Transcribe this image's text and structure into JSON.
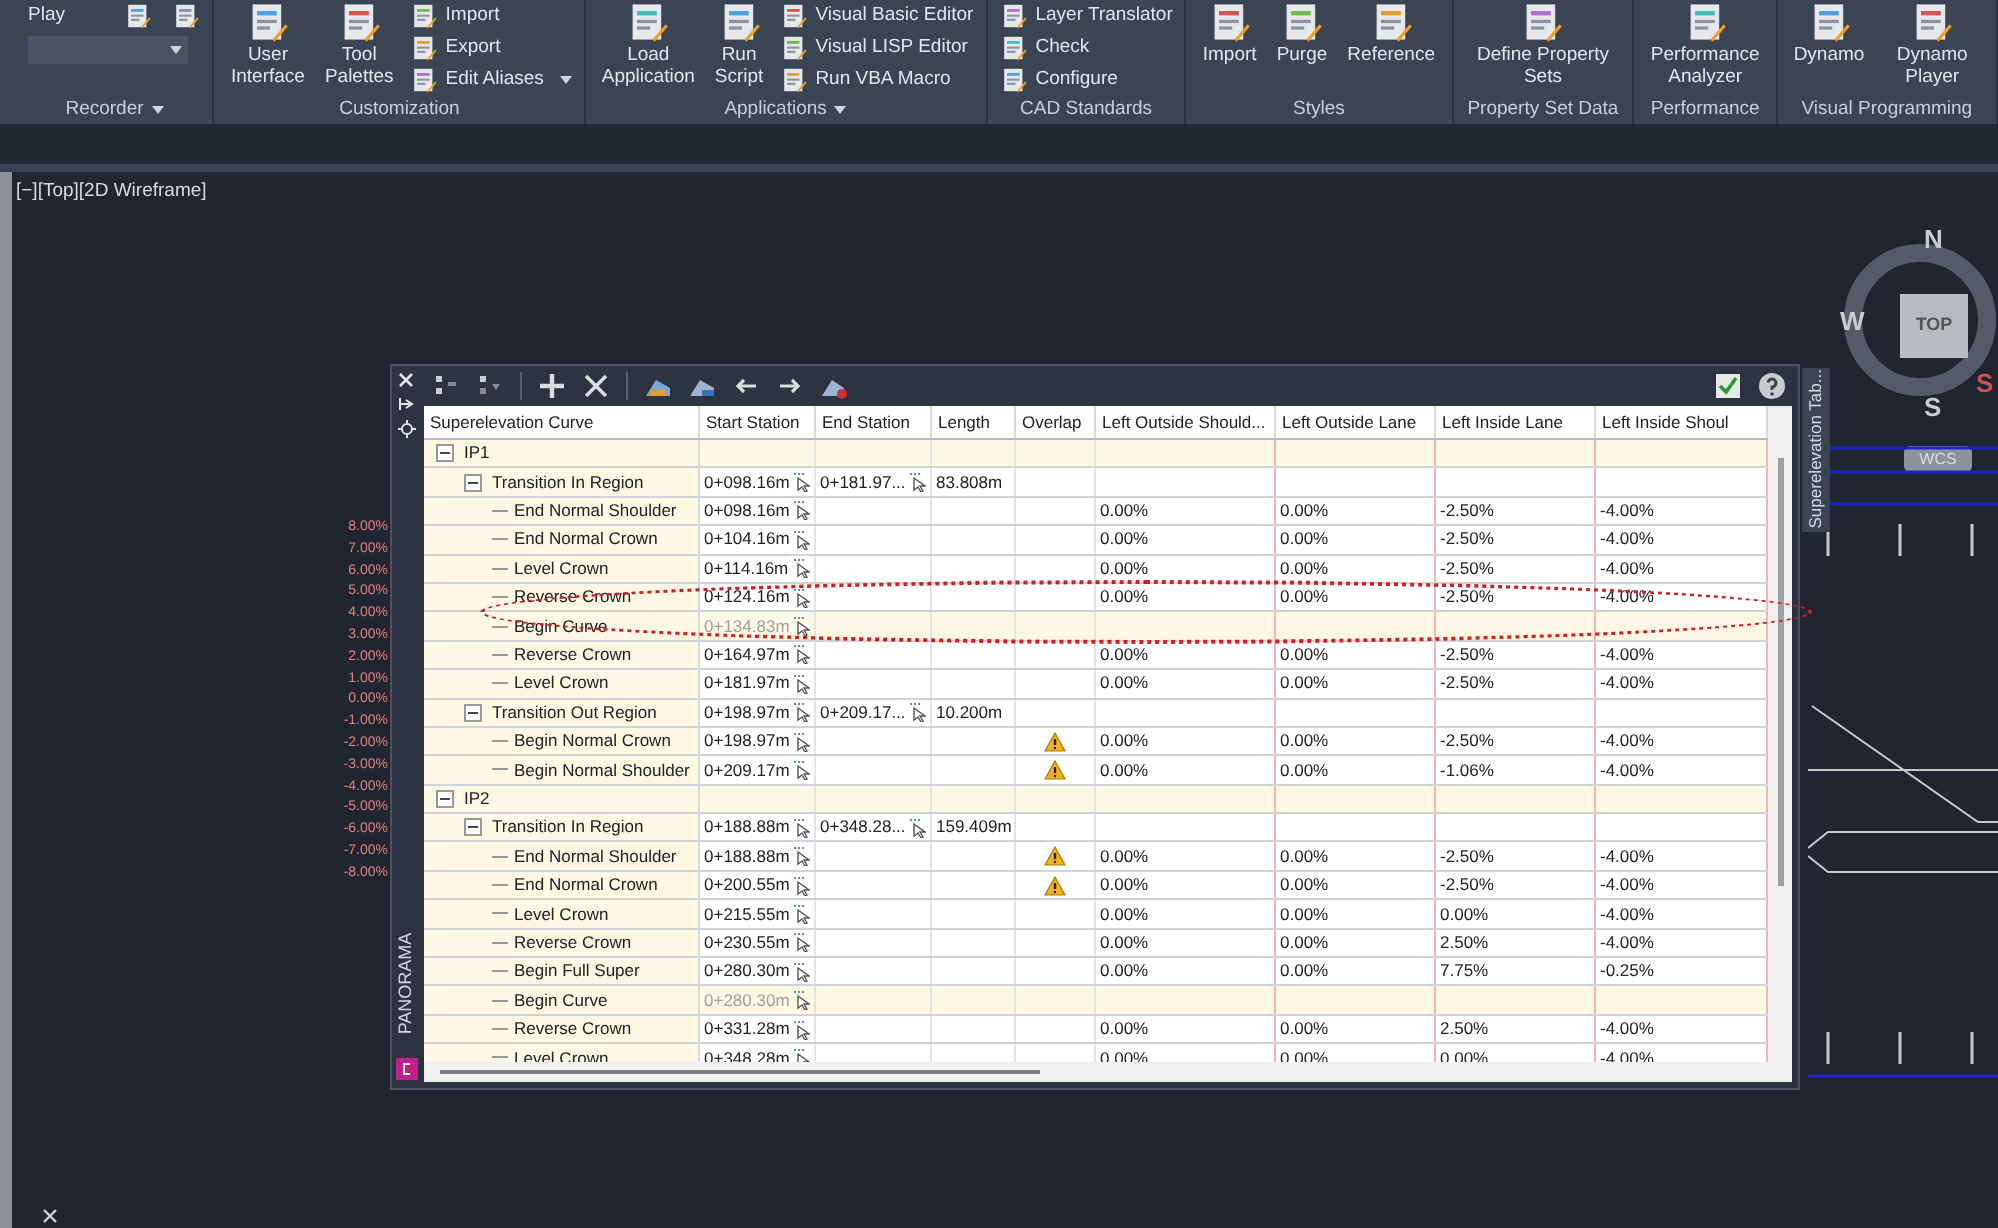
{
  "ribbon": {
    "panels": [
      {
        "title": "Recorder",
        "menu": true,
        "buttons": [
          {
            "kind": "small",
            "label": "Play"
          }
        ]
      },
      {
        "title": "Customization",
        "menu": false,
        "buttons": [
          {
            "kind": "large",
            "label": "User\nInterface"
          },
          {
            "kind": "large",
            "label": "Tool\nPalettes"
          },
          {
            "kind": "stack",
            "items": [
              {
                "label": "Import",
                "menu": false
              },
              {
                "label": "Export",
                "menu": false
              },
              {
                "label": "Edit Aliases",
                "menu": true
              }
            ]
          }
        ]
      },
      {
        "title": "Applications",
        "menu": true,
        "buttons": [
          {
            "kind": "large",
            "label": "Load\nApplication"
          },
          {
            "kind": "large",
            "label": "Run\nScript"
          },
          {
            "kind": "stack",
            "items": [
              {
                "label": "Visual Basic Editor",
                "menu": false
              },
              {
                "label": "Visual LISP Editor",
                "menu": false
              },
              {
                "label": "Run VBA Macro",
                "menu": false
              }
            ]
          }
        ]
      },
      {
        "title": "CAD Standards",
        "menu": false,
        "buttons": [
          {
            "kind": "stack",
            "items": [
              {
                "label": "Layer Translator",
                "menu": false
              },
              {
                "label": "Check",
                "menu": false
              },
              {
                "label": "Configure",
                "menu": false
              }
            ]
          }
        ]
      },
      {
        "title": "Styles",
        "menu": false,
        "buttons": [
          {
            "kind": "large",
            "label": "Import"
          },
          {
            "kind": "large",
            "label": "Purge"
          },
          {
            "kind": "large",
            "label": "Reference"
          }
        ]
      },
      {
        "title": "Property Set Data",
        "menu": false,
        "buttons": [
          {
            "kind": "large",
            "label": "Define Property Sets"
          }
        ]
      },
      {
        "title": "Performance",
        "menu": false,
        "buttons": [
          {
            "kind": "large",
            "label": "Performance\nAnalyzer"
          }
        ]
      },
      {
        "title": "Visual Programming",
        "menu": false,
        "buttons": [
          {
            "kind": "large",
            "label": "Dynamo"
          },
          {
            "kind": "large",
            "label": "Dynamo Player"
          }
        ]
      }
    ]
  },
  "viewport": {
    "label": "[−][Top][2D Wireframe]"
  },
  "viewcube": {
    "north": "N",
    "west": "W",
    "south": "S",
    "face": "TOP",
    "east_cut": "S",
    "ucs": "WCS"
  },
  "scale_labels": [
    "8.00%",
    "7.00%",
    "6.00%",
    "5.00%",
    "4.00%",
    "3.00%",
    "2.00%",
    "1.00%",
    "0.00%",
    "-1.00%",
    "-2.00%",
    "-3.00%",
    "-4.00%",
    "-5.00%",
    "-6.00%",
    "-7.00%",
    "-8.00%"
  ],
  "panorama": {
    "title": "PANORAMA",
    "tab": "Superelevation Tab...",
    "table": {
      "columns": [
        "Superelevation Curve",
        "Start Station",
        "End Station",
        "Length",
        "Overlap",
        "Left Outside Should...",
        "Left Outside Lane",
        "Left Inside Lane",
        "Left Inside Shoul"
      ],
      "rows": [
        {
          "kind": "group",
          "label": "IP1",
          "expanded": true,
          "children": [
            {
              "kind": "region",
              "label": "Transition In Region",
              "expanded": true,
              "start_station": "0+098.16m",
              "end_station": "0+181.97...",
              "length": "83.808m",
              "children": [
                {
                  "kind": "point",
                  "label": "End Normal Shoulder",
                  "disabled": false,
                  "overlap_warning": false,
                  "start_station": "0+098.16m",
                  "values": [
                    "0.00%",
                    "0.00%",
                    "-2.50%",
                    "-4.00%"
                  ]
                },
                {
                  "kind": "point",
                  "label": "End Normal Crown",
                  "disabled": false,
                  "overlap_warning": false,
                  "start_station": "0+104.16m",
                  "values": [
                    "0.00%",
                    "0.00%",
                    "-2.50%",
                    "-4.00%"
                  ]
                },
                {
                  "kind": "point",
                  "label": "Level Crown",
                  "disabled": false,
                  "overlap_warning": false,
                  "start_station": "0+114.16m",
                  "values": [
                    "0.00%",
                    "0.00%",
                    "-2.50%",
                    "-4.00%"
                  ]
                },
                {
                  "kind": "point",
                  "label": "Reverse Crown",
                  "disabled": false,
                  "overlap_warning": false,
                  "start_station": "0+124.16m",
                  "values": [
                    "0.00%",
                    "0.00%",
                    "-2.50%",
                    "-4.00%"
                  ]
                },
                {
                  "kind": "point",
                  "label": "Begin Curve",
                  "disabled": true,
                  "overlap_warning": false,
                  "start_station": "0+134.83m"
                },
                {
                  "kind": "point",
                  "label": "Reverse Crown",
                  "disabled": false,
                  "overlap_warning": false,
                  "start_station": "0+164.97m",
                  "values": [
                    "0.00%",
                    "0.00%",
                    "-2.50%",
                    "-4.00%"
                  ]
                },
                {
                  "kind": "point",
                  "label": "Level Crown",
                  "disabled": false,
                  "overlap_warning": false,
                  "start_station": "0+181.97m",
                  "values": [
                    "0.00%",
                    "0.00%",
                    "-2.50%",
                    "-4.00%"
                  ]
                }
              ]
            },
            {
              "kind": "region",
              "label": "Transition Out Region",
              "expanded": true,
              "start_station": "0+198.97m",
              "end_station": "0+209.17...",
              "length": "10.200m",
              "children": [
                {
                  "kind": "point",
                  "label": "Begin Normal Crown",
                  "disabled": false,
                  "overlap_warning": true,
                  "start_station": "0+198.97m",
                  "values": [
                    "0.00%",
                    "0.00%",
                    "-2.50%",
                    "-4.00%"
                  ]
                },
                {
                  "kind": "point",
                  "label": "Begin Normal Shoulder",
                  "disabled": false,
                  "overlap_warning": true,
                  "start_station": "0+209.17m",
                  "values": [
                    "0.00%",
                    "0.00%",
                    "-1.06%",
                    "-4.00%"
                  ]
                }
              ]
            }
          ]
        },
        {
          "kind": "group",
          "label": "IP2",
          "expanded": true,
          "children": [
            {
              "kind": "region",
              "label": "Transition In Region",
              "expanded": true,
              "start_station": "0+188.88m",
              "end_station": "0+348.28...",
              "length": "159.409m",
              "children": [
                {
                  "kind": "point",
                  "label": "End Normal Shoulder",
                  "disabled": false,
                  "overlap_warning": true,
                  "start_station": "0+188.88m",
                  "values": [
                    "0.00%",
                    "0.00%",
                    "-2.50%",
                    "-4.00%"
                  ]
                },
                {
                  "kind": "point",
                  "label": "End Normal Crown",
                  "disabled": false,
                  "overlap_warning": true,
                  "start_station": "0+200.55m",
                  "values": [
                    "0.00%",
                    "0.00%",
                    "-2.50%",
                    "-4.00%"
                  ]
                },
                {
                  "kind": "point",
                  "label": "Level Crown",
                  "disabled": false,
                  "overlap_warning": false,
                  "start_station": "0+215.55m",
                  "values": [
                    "0.00%",
                    "0.00%",
                    "0.00%",
                    "-4.00%"
                  ]
                },
                {
                  "kind": "point",
                  "label": "Reverse Crown",
                  "disabled": false,
                  "overlap_warning": false,
                  "start_station": "0+230.55m",
                  "values": [
                    "0.00%",
                    "0.00%",
                    "2.50%",
                    "-4.00%"
                  ]
                },
                {
                  "kind": "point",
                  "label": "Begin Full Super",
                  "disabled": false,
                  "overlap_warning": false,
                  "start_station": "0+280.30m",
                  "values": [
                    "0.00%",
                    "0.00%",
                    "7.75%",
                    "-0.25%"
                  ]
                },
                {
                  "kind": "point",
                  "label": "Begin Curve",
                  "disabled": true,
                  "overlap_warning": false,
                  "start_station": "0+280.30m"
                },
                {
                  "kind": "point",
                  "label": "Reverse Crown",
                  "disabled": false,
                  "overlap_warning": false,
                  "start_station": "0+331.28m",
                  "values": [
                    "0.00%",
                    "0.00%",
                    "2.50%",
                    "-4.00%"
                  ]
                },
                {
                  "kind": "point",
                  "label": "Level Crown",
                  "disabled": false,
                  "overlap_warning": false,
                  "start_station": "0+348.28m",
                  "values": [
                    "0.00%",
                    "0.00%",
                    "0.00%",
                    "-4.00%"
                  ]
                }
              ]
            }
          ]
        }
      ]
    }
  }
}
